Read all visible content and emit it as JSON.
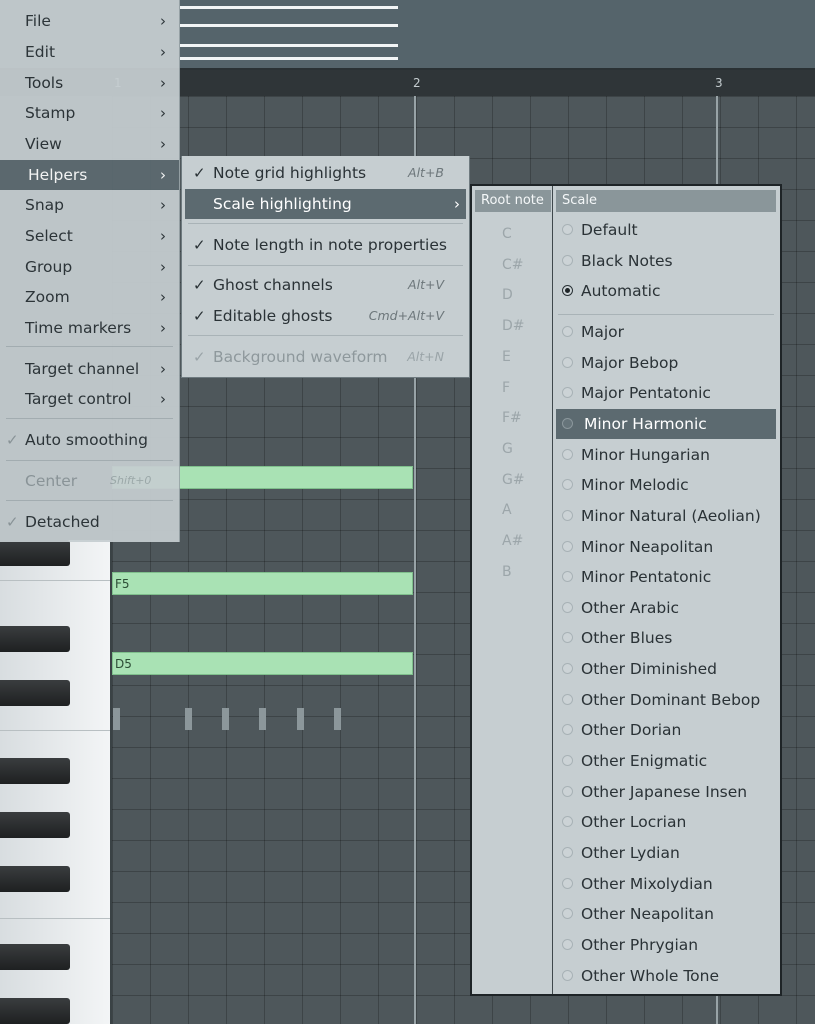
{
  "piano_roll": {
    "ruler_marks": [
      "1",
      "2",
      "3"
    ],
    "notes": [
      {
        "label": ""
      },
      {
        "label": "F5"
      },
      {
        "label": "D5"
      }
    ],
    "colors": {
      "note_fill": "#a9e2b4",
      "grid": "#4e575b"
    }
  },
  "main_menu": {
    "items": [
      {
        "label": "File",
        "has_submenu": true
      },
      {
        "label": "Edit",
        "has_submenu": true
      },
      {
        "label": "Tools",
        "has_submenu": true
      },
      {
        "label": "Stamp",
        "has_submenu": true
      },
      {
        "label": "View",
        "has_submenu": true
      },
      {
        "label": "Helpers",
        "has_submenu": true,
        "highlighted": true
      },
      {
        "label": "Snap",
        "has_submenu": true
      },
      {
        "label": "Select",
        "has_submenu": true
      },
      {
        "label": "Group",
        "has_submenu": true
      },
      {
        "label": "Zoom",
        "has_submenu": true
      },
      {
        "label": "Time markers",
        "has_submenu": true
      },
      {
        "label": "Target channel",
        "has_submenu": true
      },
      {
        "label": "Target control",
        "has_submenu": true
      },
      {
        "label": "Auto smoothing",
        "checked": true
      },
      {
        "label": "Center",
        "shortcut": "Shift+0",
        "disabled": true
      },
      {
        "label": "Detached",
        "checked": true
      }
    ]
  },
  "helpers_menu": {
    "items": [
      {
        "label": "Note grid highlights",
        "checked": true,
        "shortcut": "Alt+B"
      },
      {
        "label": "Scale highlighting",
        "has_submenu": true,
        "highlighted": true
      },
      {
        "label": "Note length in note properties",
        "checked": true
      },
      {
        "label": "Ghost channels",
        "checked": true,
        "shortcut": "Alt+V"
      },
      {
        "label": "Editable ghosts",
        "checked": true,
        "shortcut": "Cmd+Alt+V"
      },
      {
        "label": "Background waveform",
        "checked": true,
        "shortcut": "Alt+N",
        "disabled": true
      }
    ]
  },
  "scale_panel": {
    "root_header": "Root note",
    "scale_header": "Scale",
    "root_notes": [
      "C",
      "C#",
      "D",
      "D#",
      "E",
      "F",
      "F#",
      "G",
      "G#",
      "A",
      "A#",
      "B"
    ],
    "scales": [
      {
        "label": "Default"
      },
      {
        "label": "Black Notes"
      },
      {
        "label": "Automatic",
        "selected": true
      },
      {
        "label": "Major"
      },
      {
        "label": "Major Bebop"
      },
      {
        "label": "Major Pentatonic"
      },
      {
        "label": "Minor Harmonic",
        "highlighted": true
      },
      {
        "label": "Minor Hungarian"
      },
      {
        "label": "Minor Melodic"
      },
      {
        "label": "Minor Natural (Aeolian)"
      },
      {
        "label": "Minor Neapolitan"
      },
      {
        "label": "Minor Pentatonic"
      },
      {
        "label": "Other Arabic"
      },
      {
        "label": "Other Blues"
      },
      {
        "label": "Other Diminished"
      },
      {
        "label": "Other Dominant Bebop"
      },
      {
        "label": "Other Dorian"
      },
      {
        "label": "Other Enigmatic"
      },
      {
        "label": "Other Japanese Insen"
      },
      {
        "label": "Other Locrian"
      },
      {
        "label": "Other Lydian"
      },
      {
        "label": "Other Mixolydian"
      },
      {
        "label": "Other Neapolitan"
      },
      {
        "label": "Other Phrygian"
      },
      {
        "label": "Other Whole Tone"
      }
    ]
  },
  "icons": {
    "submenu_arrow": "chevron-right-icon",
    "check": "check-icon",
    "radio": "radio-icon"
  }
}
